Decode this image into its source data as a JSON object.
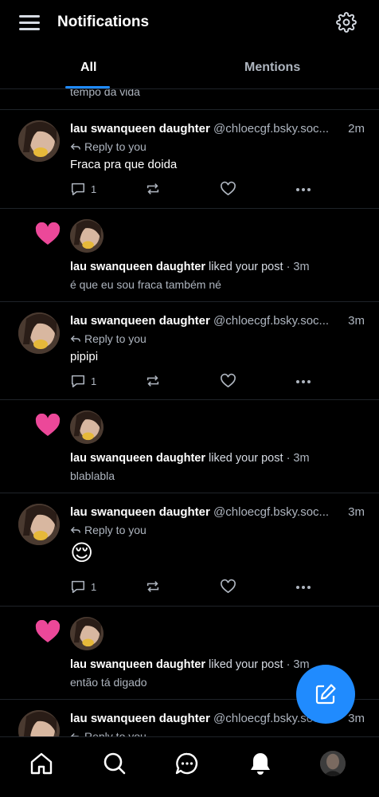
{
  "header": {
    "title": "Notifications",
    "menu_icon": "hamburger-menu-icon",
    "settings_icon": "gear-icon"
  },
  "tabs": [
    {
      "label": "All",
      "active": true
    },
    {
      "label": "Mentions",
      "active": false
    }
  ],
  "feed": {
    "cut_text": "tempo da vida",
    "replies": [
      {
        "name": "lau swanqueen daughter",
        "handle": "@chloecgf.bsky.soc...",
        "time": "2m",
        "reply_label": "Reply to you",
        "text": "Fraca pra que doida",
        "reply_count": "1"
      },
      {
        "name": "lau swanqueen daughter",
        "handle": "@chloecgf.bsky.soc...",
        "time": "3m",
        "reply_label": "Reply to you",
        "text": "pipipi",
        "reply_count": "1"
      },
      {
        "name": "lau swanqueen daughter",
        "handle": "@chloecgf.bsky.soc...",
        "time": "3m",
        "reply_label": "Reply to you",
        "text": "😌",
        "reply_count": "1"
      },
      {
        "name": "lau swanqueen daughter",
        "handle": "@chloecgf.bsky.soc...",
        "time": "3m",
        "reply_label": "Reply to you"
      }
    ],
    "likes": [
      {
        "name": "lau swanqueen daughter",
        "verb": "liked your post",
        "time": "· 3m",
        "post": "é que eu sou fraca também né"
      },
      {
        "name": "lau swanqueen daughter",
        "verb": "liked your post",
        "time": "· 3m",
        "post": "blablabla"
      },
      {
        "name": "lau swanqueen daughter",
        "verb": "liked your post",
        "time": "· 3m",
        "post": "então tá digado"
      }
    ]
  },
  "colors": {
    "accent": "#208bfe",
    "like_heart": "#ec4899",
    "background": "#000000",
    "muted_text": "#aeb5bf"
  },
  "bottom_nav": [
    "home-icon",
    "search-icon",
    "chat-icon",
    "bell-icon",
    "profile-avatar"
  ]
}
